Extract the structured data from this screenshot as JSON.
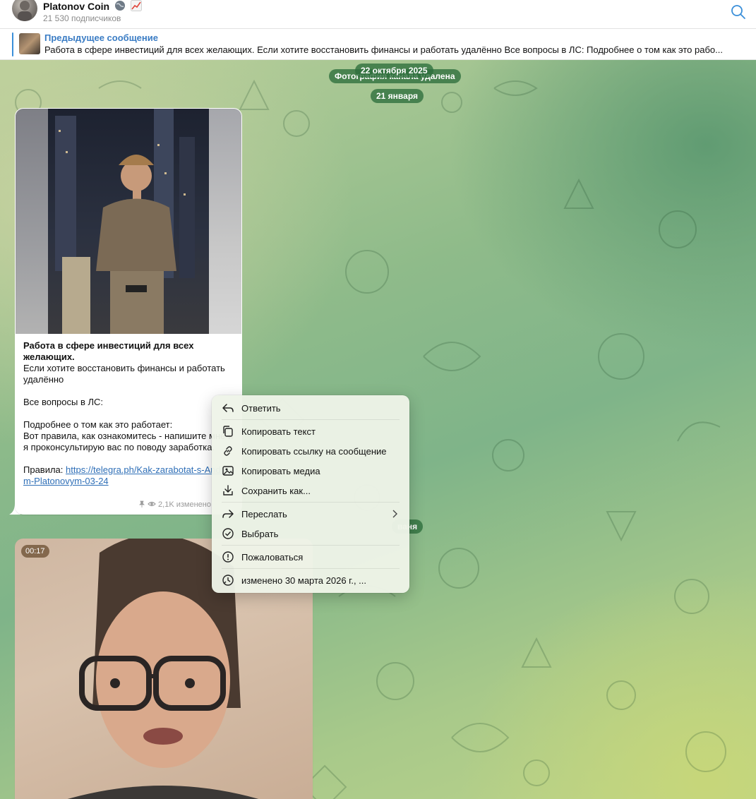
{
  "header": {
    "title": "Platonov Coin",
    "subscribers": "21 530 подписчиков"
  },
  "pinned": {
    "title": "Предыдущее сообщение",
    "text": "Работа в сфере инвестиций для всех желающих.  Если хотите восстановить финансы и работать удалённо   Все вопросы в ЛС:  Подробнее о том как это рабо..."
  },
  "chat": {
    "service_message": "Фотография канала удалена",
    "date_1": "22 октября 2025",
    "date_2": "21 января",
    "date_3_partial": "ваня"
  },
  "message1": {
    "caption_bold": "Работа в сфере инвестиций для всех желающих.",
    "line1": "Если хотите восстановить финансы и работать удалённо",
    "line2": "Все вопросы в ЛС:",
    "line3": "Подробнее о том как это работает:",
    "line4": "Вот правила, как ознакомитесь - напишите мне и я проконсультирую вас по поводу заработка.",
    "rules_label": "Правила:",
    "link": "https://telegra.ph/Kak-zarabotat-s-Andreem-Platonovym-03-24",
    "views": "2,1K",
    "edited": "изменено"
  },
  "message2": {
    "duration": "00:17"
  },
  "context_menu": {
    "items": [
      {
        "label": "Ответить",
        "icon": "reply-icon"
      },
      {
        "label": "Копировать текст",
        "icon": "copy-icon"
      },
      {
        "label": "Копировать ссылку на сообщение",
        "icon": "link-icon"
      },
      {
        "label": "Копировать медиа",
        "icon": "image-icon"
      },
      {
        "label": "Сохранить как...",
        "icon": "download-icon"
      },
      {
        "label": "Переслать",
        "icon": "forward-icon"
      },
      {
        "label": "Выбрать",
        "icon": "check-circle-icon"
      },
      {
        "label": "Пожаловаться",
        "icon": "warning-icon"
      },
      {
        "label": "изменено 30 марта 2026 г., ...",
        "icon": "clock-icon"
      }
    ]
  },
  "colors": {
    "accent": "#3a7cc4",
    "link": "#2f6fb7",
    "pill": "#2d6e3c"
  }
}
